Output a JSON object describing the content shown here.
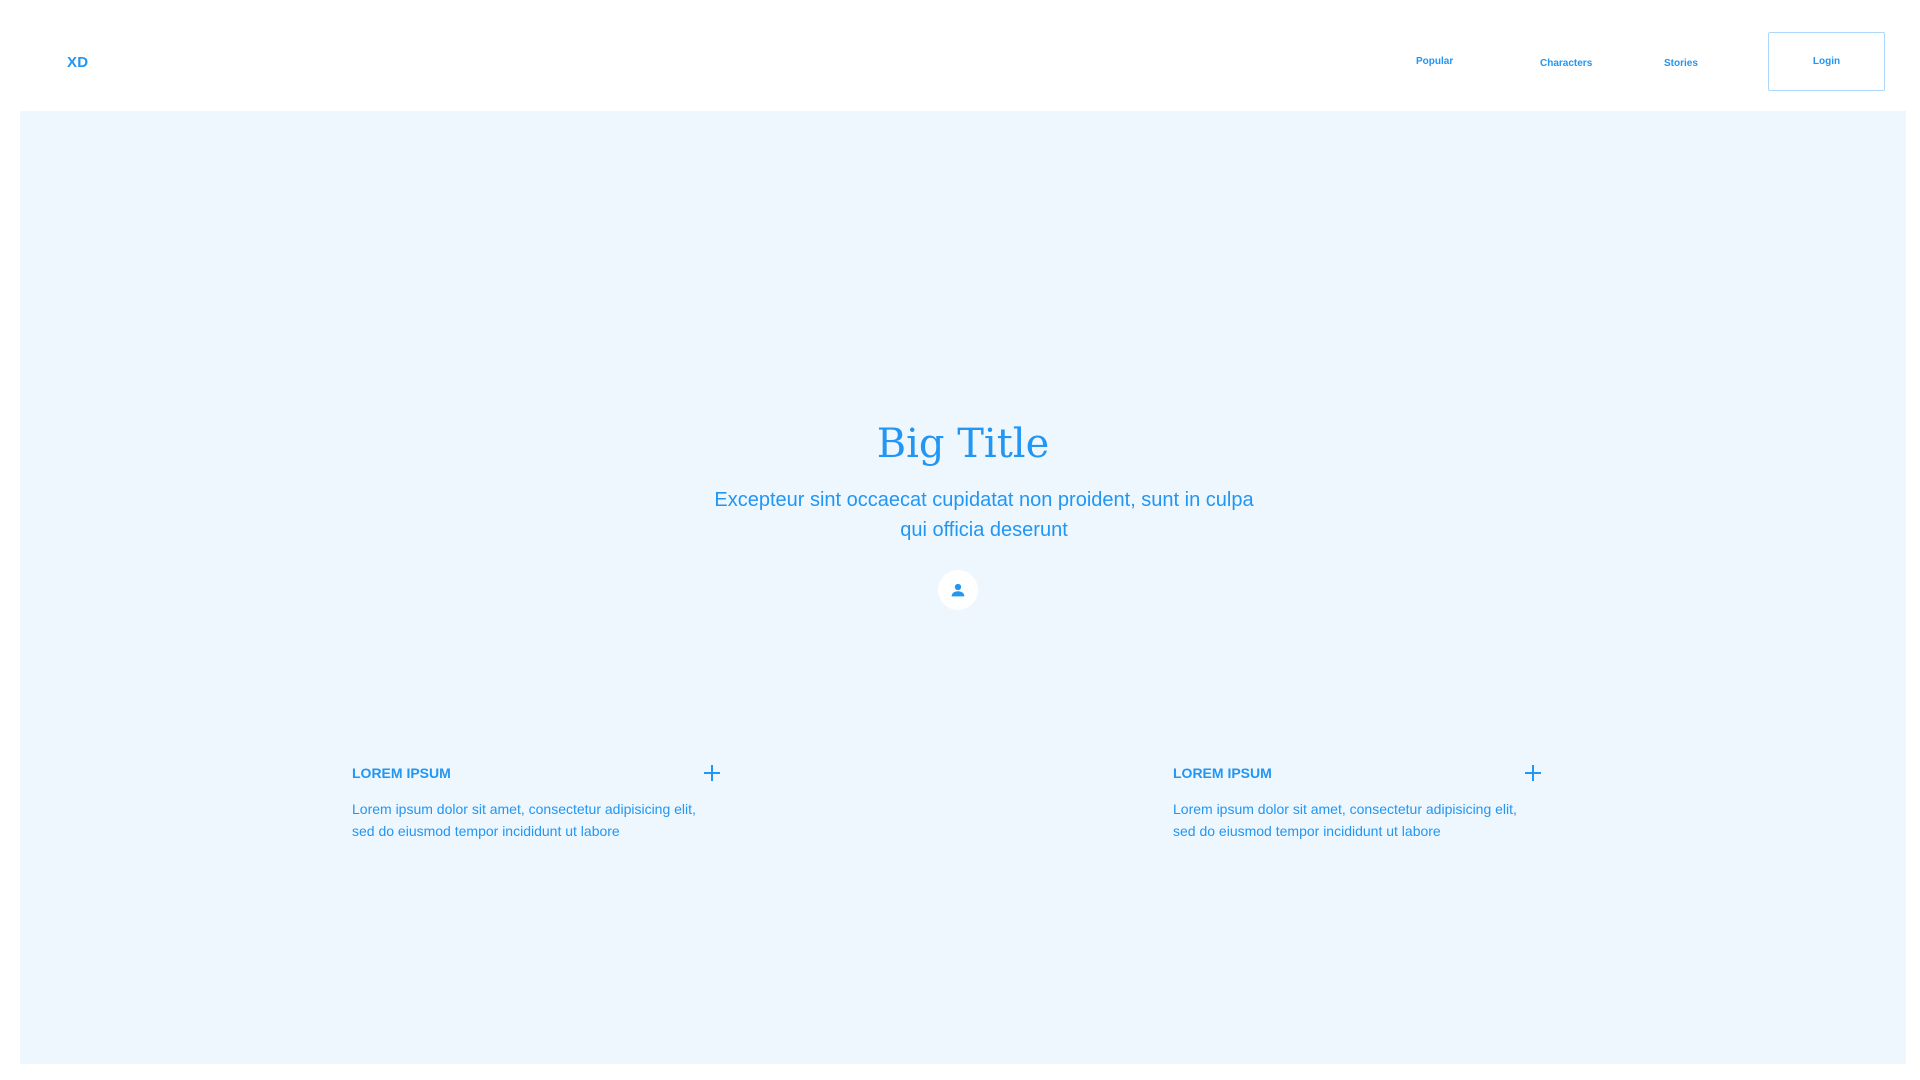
{
  "header": {
    "logo": "XD",
    "nav": {
      "popular": "Popular",
      "characters": "Characters",
      "stories": "Stories"
    },
    "login_label": "Login"
  },
  "hero": {
    "title": "Big Title",
    "subtitle": "Excepteur sint occaecat cupidatat non proident, sunt in culpa qui officia deserunt",
    "avatar_icon": "user-icon"
  },
  "features": [
    {
      "title": "LOREM IPSUM",
      "text": "Lorem ipsum dolor sit amet, consectetur adipisicing elit, sed do eiusmod tempor incididunt ut labore",
      "icon": "plus-icon"
    },
    {
      "title": "LOREM IPSUM",
      "text": "Lorem ipsum dolor sit amet, consectetur adipisicing elit, sed do eiusmod tempor incididunt ut labore",
      "icon": "plus-icon"
    }
  ],
  "colors": {
    "accent": "#2196f3",
    "hero_background": "#eff7fe",
    "button_border": "#aed8fb",
    "page_background": "#ffffff"
  }
}
